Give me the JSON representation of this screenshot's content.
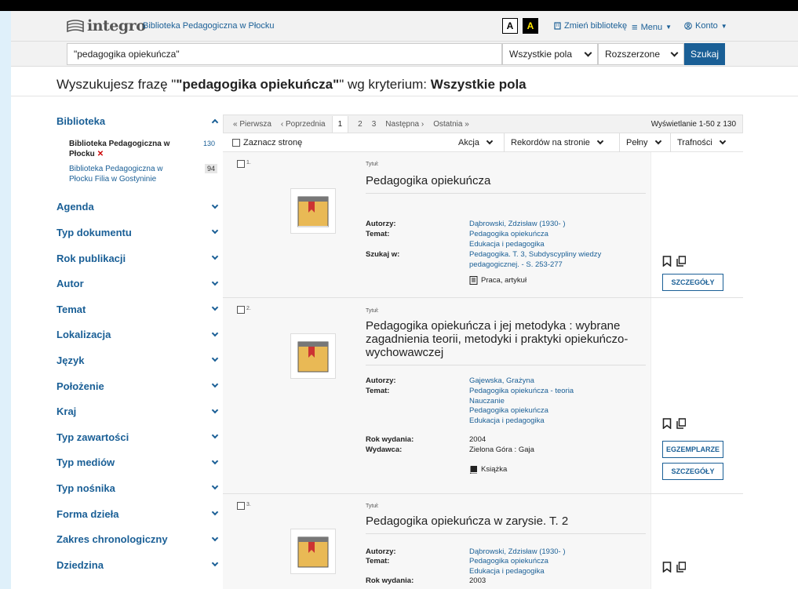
{
  "header": {
    "logo_text": "integro",
    "library_name": "Biblioteka Pedagogiczna w Płocku",
    "contrast_normal": "A",
    "contrast_high": "A",
    "change_library": "Zmień bibliotekę",
    "menu": "Menu",
    "account": "Konto"
  },
  "search": {
    "query": "\"pedagogika opiekuńcza\"",
    "field": "Wszystkie pola",
    "mode": "Rozszerzone",
    "submit": "Szukaj"
  },
  "heading": {
    "prefix": "Wyszukujesz frazę \"",
    "phrase": "\"pedagogika opiekuńcza\"",
    "middle": "\" wg kryterium: ",
    "criterion": "Wszystkie pola"
  },
  "sidebar": {
    "library_facet": "Biblioteka",
    "libraries": [
      {
        "name": "Biblioteka Pedagogiczna w Płocku",
        "count": "130",
        "remove": "✕"
      },
      {
        "name": "Biblioteka Pedagogiczna w Płocku Filia w Gostyninie",
        "count": "94"
      }
    ],
    "facets": [
      "Agenda",
      "Typ dokumentu",
      "Rok publikacji",
      "Autor",
      "Temat",
      "Lokalizacja",
      "Język",
      "Położenie",
      "Kraj",
      "Typ zawartości",
      "Typ mediów",
      "Typ nośnika",
      "Forma dzieła",
      "Zakres chronologiczny",
      "Dziedzina"
    ]
  },
  "pager": {
    "first": "« Pierwsza",
    "prev": "‹ Poprzednia",
    "pages": [
      "1",
      "2",
      "3"
    ],
    "next": "Następna ›",
    "last": "Ostatnia »",
    "showing": "Wyświetlanie 1-50 z 130"
  },
  "toolbar": {
    "select_page": "Zaznacz stronę",
    "action": "Akcja",
    "per_page": "Rekordów na stronie",
    "view": "Pełny",
    "sort": "Trafności"
  },
  "labels": {
    "title": "Tytuł:",
    "authors": "Autorzy:",
    "subject": "Temat:",
    "search_in": "Szukaj w:",
    "year": "Rok wydania:",
    "publisher": "Wydawca:",
    "details": "SZCZEGÓŁY",
    "copies": "EGZEMPLARZE"
  },
  "records": [
    {
      "num": "1.",
      "title": "Pedagogika opiekuńcza",
      "authors": "Dąbrowski, Zdzisław (1930- )",
      "subjects": [
        "Pedagogika opiekuńcza",
        "Edukacja i pedagogika"
      ],
      "search_in": "Pedagogika. T. 3, Subdyscypliny wiedzy pedagogicznej. - S. 253-277",
      "doc_type": "Praca, artykuł"
    },
    {
      "num": "2.",
      "title": "Pedagogika opiekuńcza i jej metodyka : wybrane zagadnienia teorii, metodyki i praktyki opiekuńczo-wychowawczej",
      "authors": "Gajewska, Grażyna",
      "subjects": [
        "Pedagogika opiekuńcza - teoria",
        "Nauczanie",
        "Pedagogika opiekuńcza",
        "Edukacja i pedagogika"
      ],
      "year": "2004",
      "publisher": "Zielona Góra : Gaja",
      "doc_type": "Książka"
    },
    {
      "num": "3.",
      "title": "Pedagogika opiekuńcza w zarysie. T. 2",
      "authors": "Dąbrowski, Zdzisław (1930- )",
      "subjects": [
        "Pedagogika opiekuńcza",
        "Edukacja i pedagogika"
      ],
      "year": "2003"
    }
  ],
  "colors": {
    "link": "#1a5f96",
    "accent": "#1a5f96",
    "remove": "#cc0000"
  }
}
